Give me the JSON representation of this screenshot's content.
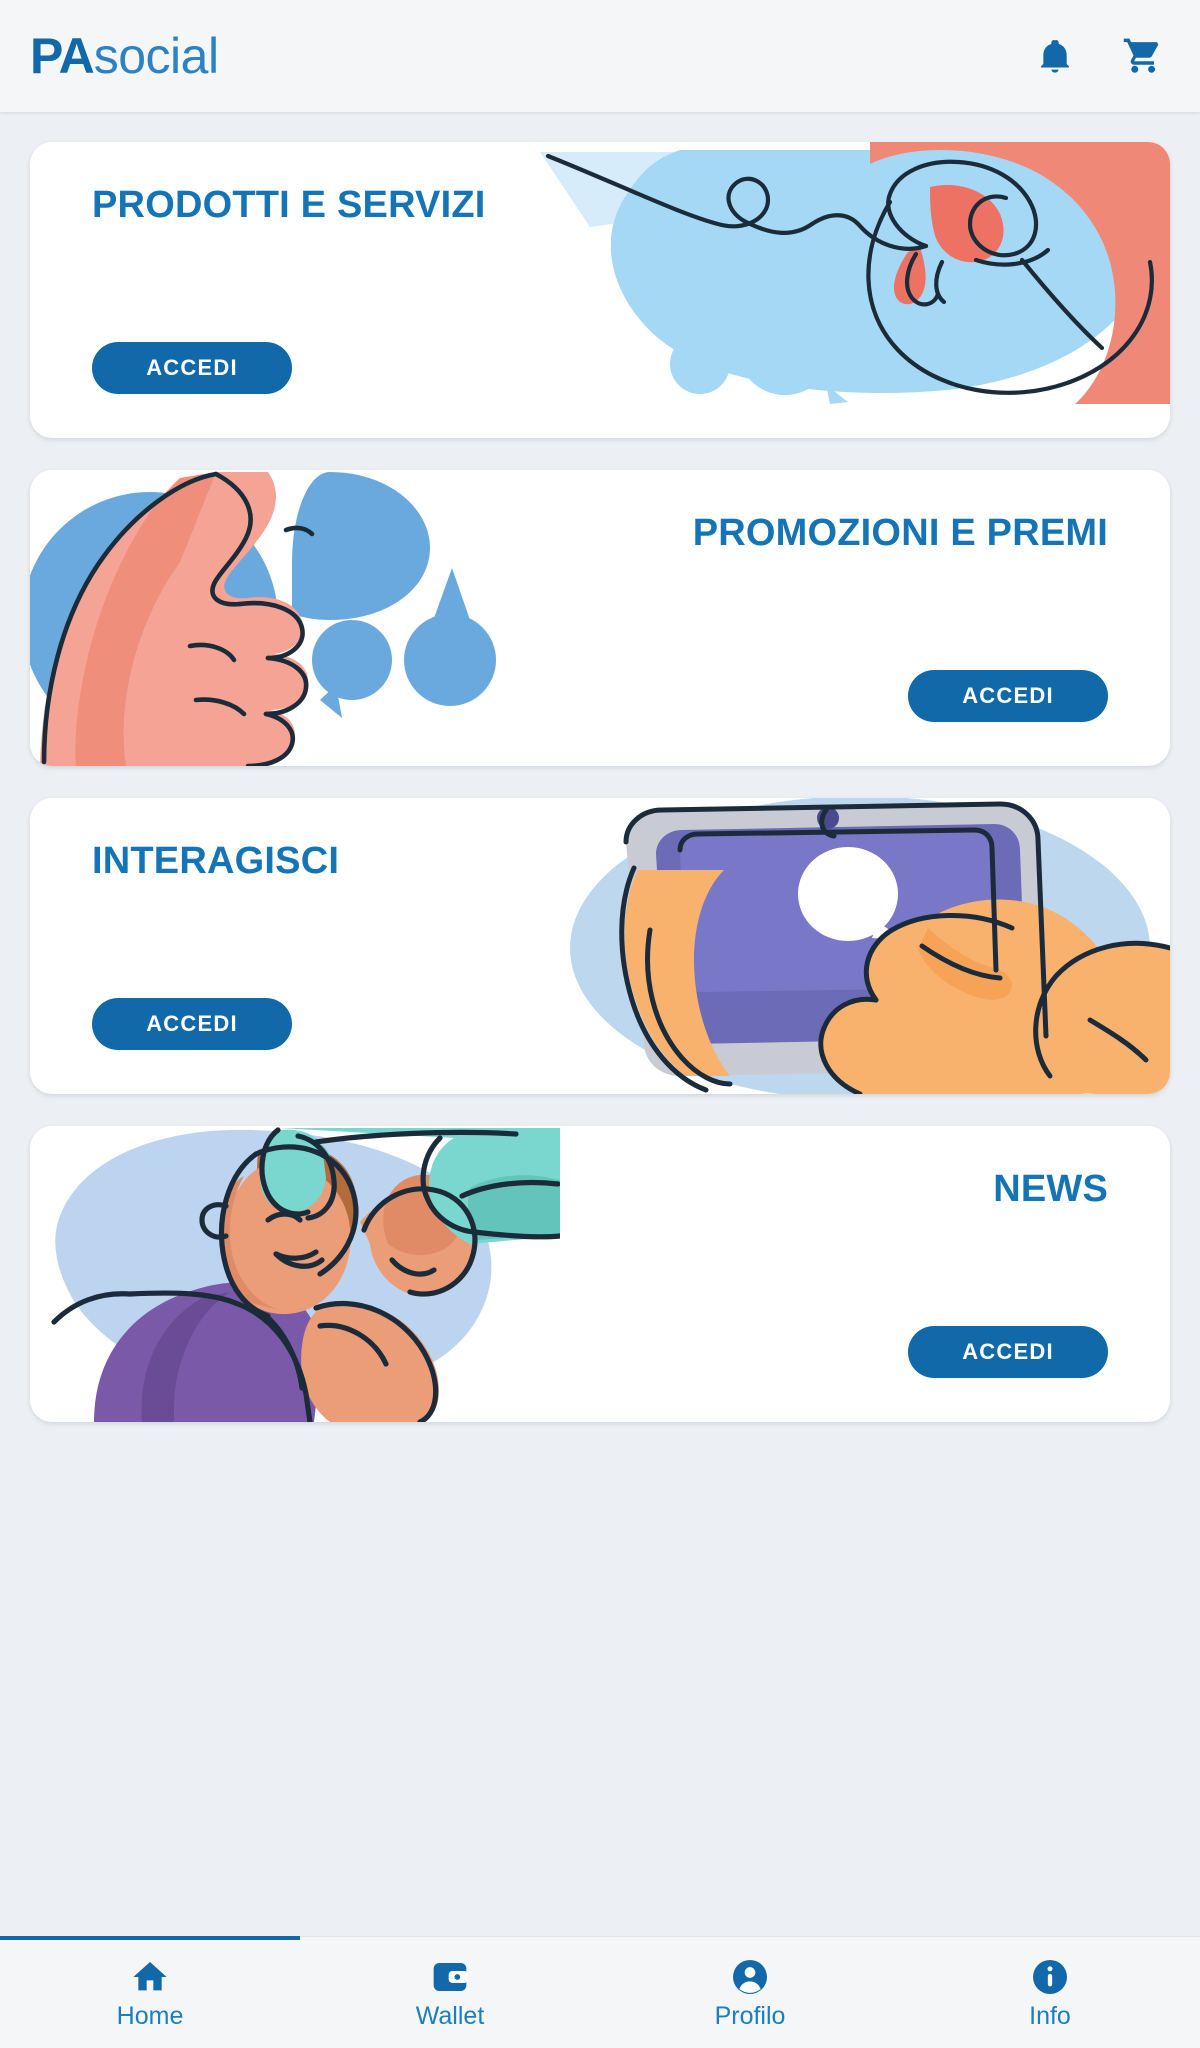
{
  "theme": {
    "page_bg": "#eceff3",
    "header_bg": "#f5f6f7",
    "brand_blue": "#1268a8",
    "title_blue": "#1574b5",
    "button_blue": "#1269aa",
    "nav_label_blue": "#1b7ec0",
    "card_white": "#ffffff"
  },
  "header": {
    "logo": {
      "bold_part": "PA",
      "light_part": "social"
    },
    "actions": [
      {
        "name": "notifications-button",
        "icon": "bell-icon",
        "label": "Notifiche"
      },
      {
        "name": "cart-button",
        "icon": "cart-icon",
        "label": "Carrello"
      }
    ]
  },
  "cards": [
    {
      "title": "PRODOTTI E SERVIZI",
      "cta_label": "ACCEDI",
      "art_side": "right",
      "illustration": "hand-pointing-illustration"
    },
    {
      "title": "PROMOZIONI E PREMI",
      "cta_label": "ACCEDI",
      "art_side": "left",
      "illustration": "thumbs-up-illustration"
    },
    {
      "title": "INTERAGISCI",
      "cta_label": "ACCEDI",
      "art_side": "right",
      "illustration": "hands-holding-tablet-illustration"
    },
    {
      "title": "NEWS",
      "cta_label": "ACCEDI",
      "art_side": "left",
      "illustration": "man-with-megaphone-illustration"
    }
  ],
  "bottom_nav": {
    "active_index": 0,
    "items": [
      {
        "label": "Home",
        "icon": "home-icon"
      },
      {
        "label": "Wallet",
        "icon": "wallet-icon"
      },
      {
        "label": "Profilo",
        "icon": "person-circle-icon"
      },
      {
        "label": "Info",
        "icon": "info-circle-icon"
      }
    ]
  }
}
